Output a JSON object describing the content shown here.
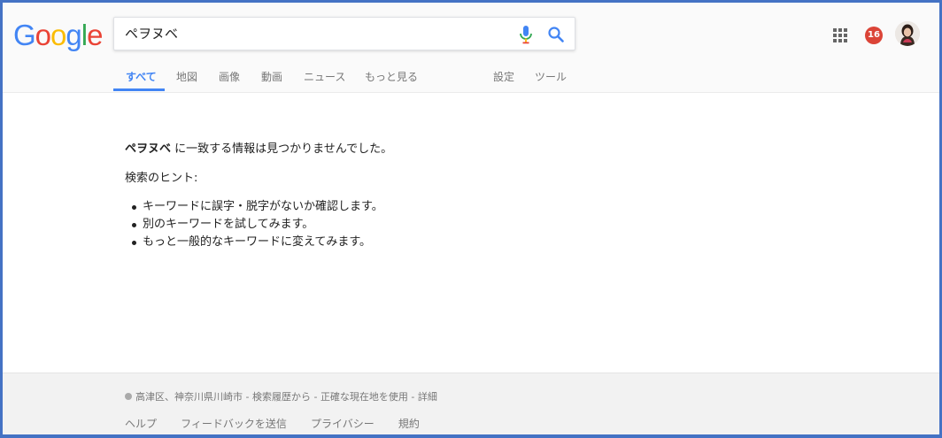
{
  "logo": {
    "letters": [
      "G",
      "o",
      "o",
      "g",
      "l",
      "e"
    ],
    "colors": [
      "#4285f4",
      "#ea4335",
      "#fbbc05",
      "#4285f4",
      "#34a853",
      "#ea4335"
    ]
  },
  "search": {
    "value": "ペヲヌベ",
    "mic_icon": "mic-icon",
    "search_icon": "search-icon"
  },
  "header_right": {
    "apps_icon": "apps-grid-icon",
    "notification_count": "16",
    "notification_color": "#db4437",
    "avatar": "avatar"
  },
  "tabs": [
    {
      "label": "すべて",
      "active": true
    },
    {
      "label": "地図"
    },
    {
      "label": "画像"
    },
    {
      "label": "動画"
    },
    {
      "label": "ニュース"
    },
    {
      "label": "もっと見る"
    },
    {
      "label": "設定"
    },
    {
      "label": "ツール"
    }
  ],
  "accent_color": "#4285f4",
  "main": {
    "query": "ペヲヌベ",
    "no_results_suffix": " に一致する情報は見つかりませんでした。",
    "hint_title": "検索のヒント:",
    "hints": [
      "キーワードに誤字・脱字がないか確認します。",
      "別のキーワードを試してみます。",
      "もっと一般的なキーワードに変えてみます。"
    ]
  },
  "footer": {
    "location": "高津区、神奈川県川崎市",
    "location_sep1": " - ",
    "location_history": "検索履歴から",
    "location_sep2": " - ",
    "location_precise": "正確な現在地を使用",
    "location_sep3": " - ",
    "location_details": "詳細",
    "links": [
      "ヘルプ",
      "フィードバックを送信",
      "プライバシー",
      "規約"
    ]
  }
}
